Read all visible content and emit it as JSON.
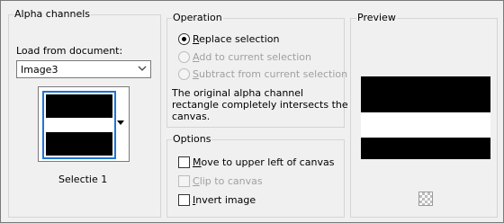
{
  "alpha_channels": {
    "title": "Alpha channels",
    "load_label": "Load from document:",
    "document_value": "Image3",
    "selection_name": "Selectie 1"
  },
  "operation": {
    "title": "Operation",
    "replace_label": "Replace selection",
    "add_label": "Add to current selection",
    "subtract_label": "Subtract from current selection",
    "selected": "replace",
    "message_line1": "The original alpha channel",
    "message_line2": "rectangle completely intersects the",
    "message_line3": "canvas."
  },
  "options": {
    "title": "Options",
    "move_label": "Move to upper left of canvas",
    "clip_label": "Clip to canvas",
    "invert_label": "Invert image",
    "move_checked": false,
    "clip_checked": false,
    "invert_checked": false
  },
  "preview": {
    "title": "Preview",
    "checker_icon": "transparency-checker-icon"
  },
  "colors": {
    "selection_border": "#1e74d6",
    "background": "#f0f0f0"
  }
}
